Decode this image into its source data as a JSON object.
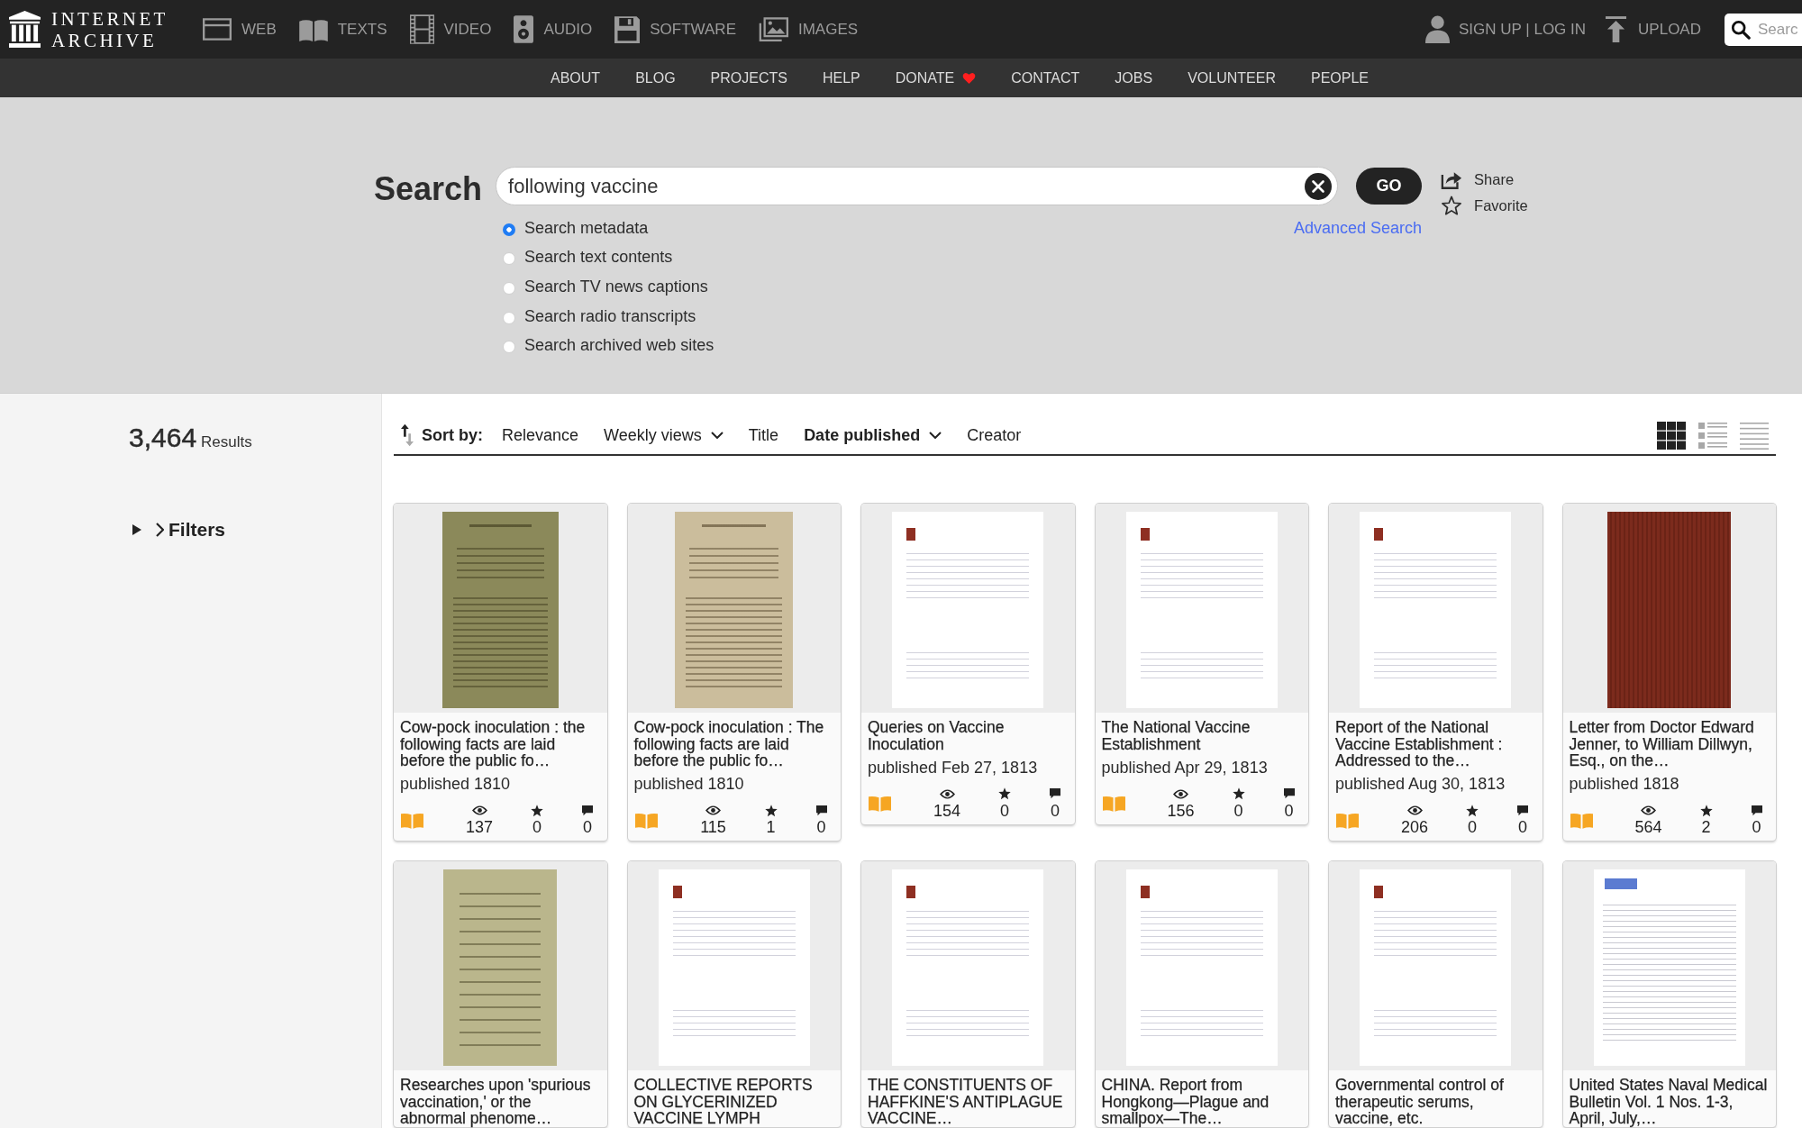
{
  "topbar": {
    "logo": "INTERNET ARCHIVE",
    "media": [
      {
        "kind": "web",
        "label": "WEB"
      },
      {
        "kind": "texts",
        "label": "TEXTS"
      },
      {
        "kind": "video",
        "label": "VIDEO"
      },
      {
        "kind": "audio",
        "label": "AUDIO"
      },
      {
        "kind": "software",
        "label": "SOFTWARE"
      },
      {
        "kind": "images",
        "label": "IMAGES"
      }
    ],
    "account": "SIGN UP | LOG IN",
    "upload": "UPLOAD",
    "search": {
      "placeholder": "Searc"
    }
  },
  "subnav": [
    {
      "label": "ABOUT",
      "heart": false
    },
    {
      "label": "BLOG",
      "heart": false
    },
    {
      "label": "PROJECTS",
      "heart": false
    },
    {
      "label": "HELP",
      "heart": false
    },
    {
      "label": "DONATE",
      "heart": true
    },
    {
      "label": "CONTACT",
      "heart": false
    },
    {
      "label": "JOBS",
      "heart": false
    },
    {
      "label": "VOLUNTEER",
      "heart": false
    },
    {
      "label": "PEOPLE",
      "heart": false
    }
  ],
  "search": {
    "heading": "Search",
    "query": "following vaccine",
    "go": "GO",
    "options": [
      {
        "label": "Search metadata",
        "selected": true
      },
      {
        "label": "Search text contents",
        "selected": false
      },
      {
        "label": "Search TV news captions",
        "selected": false
      },
      {
        "label": "Search radio transcripts",
        "selected": false
      },
      {
        "label": "Search archived web sites",
        "selected": false
      }
    ],
    "advanced": "Advanced Search",
    "actions": [
      {
        "kind": "share",
        "label": "Share"
      },
      {
        "kind": "favorite",
        "label": "Favorite"
      }
    ]
  },
  "results": {
    "count": "3,464",
    "label": "Results",
    "filters": "Filters"
  },
  "sort": {
    "label": "Sort by:",
    "options": [
      {
        "label": "Relevance",
        "selected": false,
        "dropdown": false
      },
      {
        "label": "Weekly views",
        "selected": false,
        "dropdown": true
      },
      {
        "label": "Title",
        "selected": false,
        "dropdown": false
      },
      {
        "label": "Date published",
        "selected": true,
        "dropdown": true
      },
      {
        "label": "Creator",
        "selected": false,
        "dropdown": false
      }
    ],
    "views": [
      {
        "kind": "grid",
        "selected": true
      },
      {
        "kind": "list",
        "selected": false
      },
      {
        "kind": "compact",
        "selected": false
      }
    ]
  },
  "items": [
    {
      "title": "Cow-pock inoculation : the following facts are laid before the public fo…",
      "thumb": {
        "kind": "olive"
      },
      "published": "published 1810",
      "views": "137",
      "favorites": "0",
      "reviews": "0"
    },
    {
      "title": "Cow-pock inoculation : The following facts are laid before the public fo…",
      "thumb": {
        "kind": "tan"
      },
      "published": "published 1810",
      "views": "115",
      "favorites": "1",
      "reviews": "0"
    },
    {
      "title": "Queries on Vaccine Inoculation",
      "thumb": {
        "kind": "page"
      },
      "published": "published Feb 27, 1813",
      "views": "154",
      "favorites": "0",
      "reviews": "0"
    },
    {
      "title": "The National Vaccine Establishment",
      "thumb": {
        "kind": "page"
      },
      "published": "published Apr 29, 1813",
      "views": "156",
      "favorites": "0",
      "reviews": "0"
    },
    {
      "title": "Report of the National Vaccine Establishment : Addressed to the…",
      "thumb": {
        "kind": "page"
      },
      "published": "published Aug 30, 1813",
      "views": "206",
      "favorites": "0",
      "reviews": "0"
    },
    {
      "title": "Letter from Doctor Edward Jenner, to William Dillwyn, Esq., on the…",
      "thumb": {
        "kind": "cloth"
      },
      "published": "published 1818",
      "views": "564",
      "favorites": "2",
      "reviews": "0"
    },
    {
      "title": "Researches upon 'spurious vaccination,' or the abnormal phenome…",
      "thumb": {
        "kind": "green"
      }
    },
    {
      "title": "COLLECTIVE REPORTS ON GLYCERINIZED VACCINE LYMPH",
      "thumb": {
        "kind": "page"
      }
    },
    {
      "title": "THE CONSTITUENTS OF HAFFKINE'S ANTIPLAGUE VACCINE…",
      "thumb": {
        "kind": "page"
      }
    },
    {
      "title": "CHINA. Report from Hongkong—Plague and smallpox—The…",
      "thumb": {
        "kind": "page"
      }
    },
    {
      "title": "Governmental control of therapeutic serums, vaccine, etc.",
      "thumb": {
        "kind": "page"
      }
    },
    {
      "title": "United States Naval Medical Bulletin Vol. 1 Nos. 1-3, April, July,…",
      "thumb": {
        "kind": "printed"
      }
    }
  ]
}
